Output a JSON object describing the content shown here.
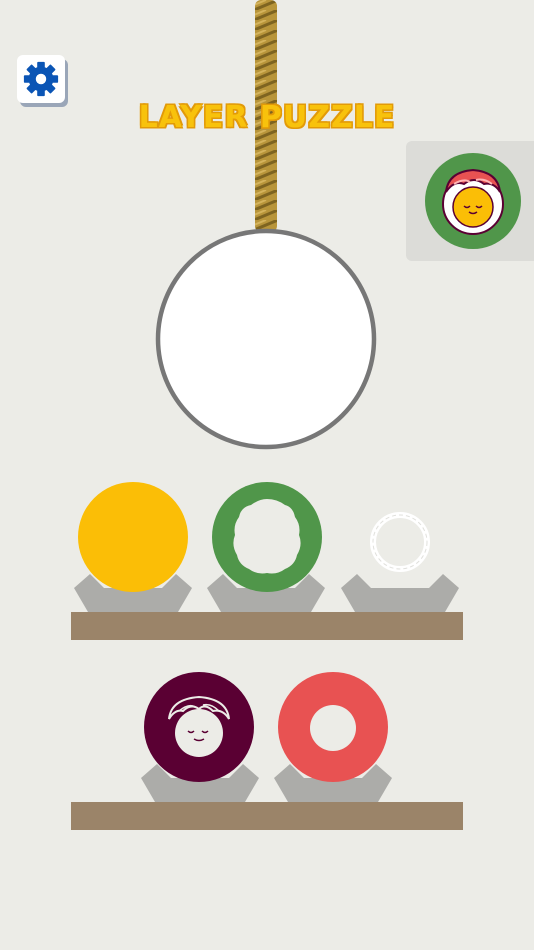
{
  "title": "LAYER PUZZLE",
  "icons": {
    "settings": "gear-icon",
    "rope": "rope-icon",
    "target": "sushi-target-icon"
  },
  "colors": {
    "background": "#ecece7",
    "title_fill": "#f8c20c",
    "settings_blue": "#0b55b5",
    "rope": "#b8953a",
    "shelf": "#9b8469",
    "stand": "#acaca9",
    "plate_border": "#777777",
    "yellow": "#fbbe06",
    "green": "#50964a",
    "white": "#ffffff",
    "maroon": "#5a0033",
    "coral": "#e85252"
  },
  "layers": {
    "top_shelf": [
      "yellow-disc",
      "green-ring",
      "white-rice-ring"
    ],
    "bottom_shelf": [
      "maroon-disc-with-face",
      "coral-ring"
    ]
  }
}
